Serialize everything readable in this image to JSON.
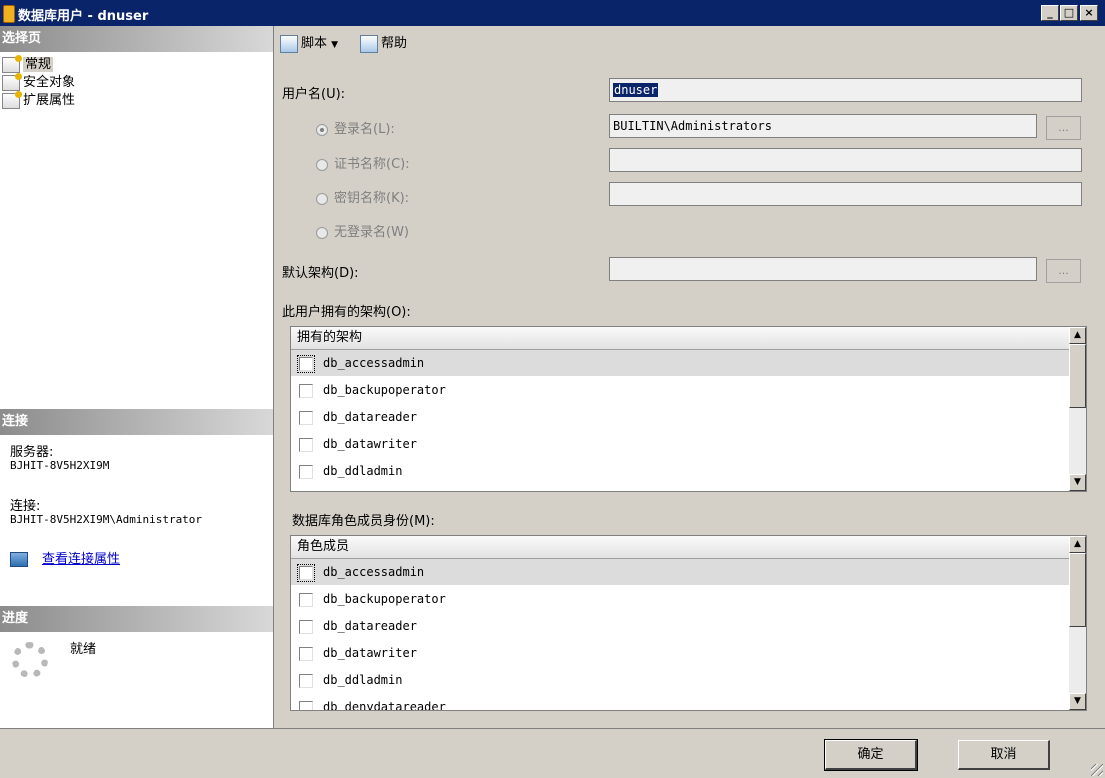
{
  "window": {
    "title": "数据库用户 - dnuser"
  },
  "sidebar": {
    "select_page_header": "选择页",
    "items": [
      {
        "label": "常规",
        "selected": true
      },
      {
        "label": "安全对象",
        "selected": false
      },
      {
        "label": "扩展属性",
        "selected": false
      }
    ],
    "connection_header": "连接",
    "server_label": "服务器:",
    "server_value": "BJHIT-8V5H2XI9M",
    "connection_label": "连接:",
    "connection_value": "BJHIT-8V5H2XI9M\\Administrator",
    "view_connection_link": "查看连接属性",
    "progress_header": "进度",
    "progress_status": "就绪"
  },
  "toolbar": {
    "script_label": "脚本",
    "help_label": "帮助"
  },
  "form": {
    "username_label": "用户名(U):",
    "username_value": "dnuser",
    "login_name_label": "登录名(L):",
    "login_name_value": "BUILTIN\\Administrators",
    "cert_name_label": "证书名称(C):",
    "key_name_label": "密钥名称(K):",
    "no_login_label": "无登录名(W)",
    "default_schema_label": "默认架构(D):",
    "ellipsis": "...",
    "owned_schemas_label": "此用户拥有的架构(O):",
    "role_membership_label": "数据库角色成员身份(M):"
  },
  "owned_schemas": {
    "header": "拥有的架构",
    "rows": [
      "db_accessadmin",
      "db_backupoperator",
      "db_datareader",
      "db_datawriter",
      "db_ddladmin"
    ]
  },
  "role_members": {
    "header": "角色成员",
    "rows": [
      "db_accessadmin",
      "db_backupoperator",
      "db_datareader",
      "db_datawriter",
      "db_ddladmin",
      "db_denydatareader"
    ]
  },
  "buttons": {
    "ok": "确定",
    "cancel": "取消"
  },
  "colors": {
    "titlebar": "#0a246a",
    "dialog": "#d4d0c8",
    "link": "#0000cc"
  }
}
